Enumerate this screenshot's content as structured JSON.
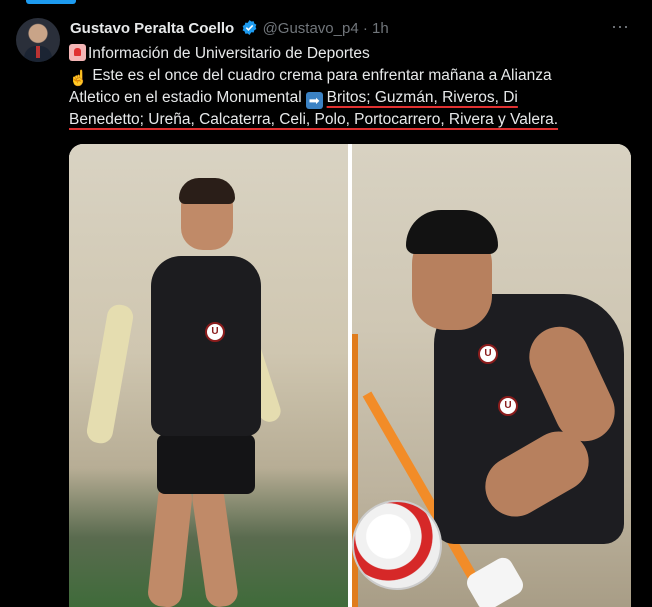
{
  "tweet": {
    "author_name": "Gustavo Peralta Coello",
    "handle": "@Gustavo_p4",
    "separator": "·",
    "time": "1h",
    "more_icon": "⋯",
    "verified_color": "#1d9bf0",
    "line1": "Información de Universitario de Deportes",
    "line2": "Este es el once del cuadro crema para enfrentar mañana a Alianza",
    "line3_pre": "Atletico en el estadio Monumental",
    "line3_ul": "Britos; Guzmán, Riveros, Di",
    "line4": "Benedetto; Ureña, Calcaterra, Celi, Polo, Portocarrero, Rivera y Valera.",
    "emoji_siren": "siren-icon",
    "emoji_hand": "☝",
    "emoji_arrow": "➡"
  },
  "media": {
    "left_crest": "U",
    "right_crest_1": "U",
    "right_crest_2": "U"
  }
}
